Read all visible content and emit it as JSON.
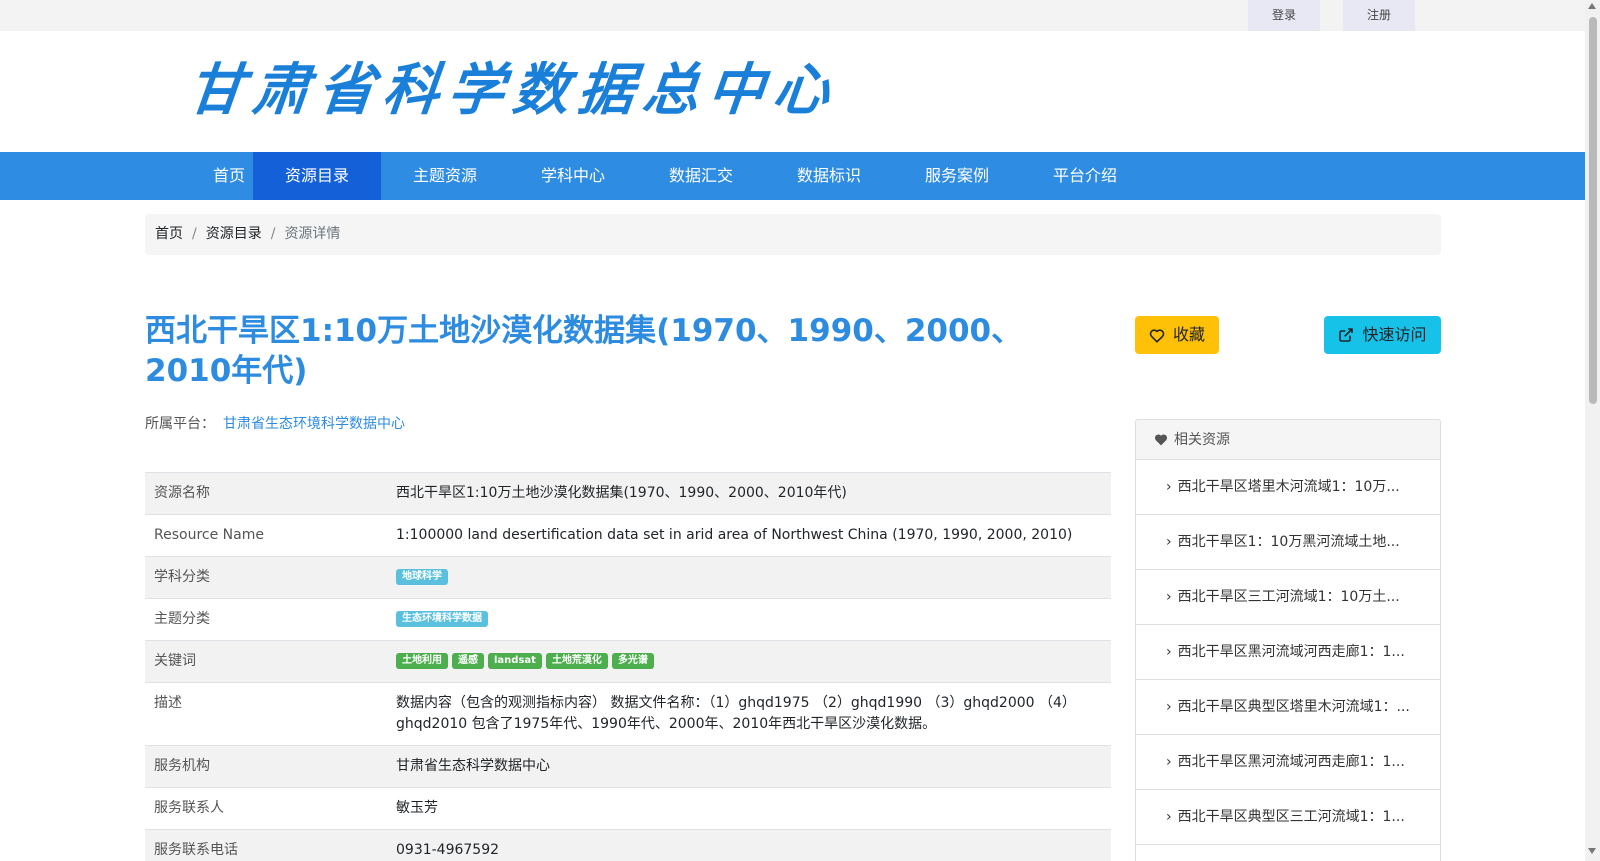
{
  "topbar": {
    "login": "登录",
    "register": "注册"
  },
  "logo": {
    "text": "甘肃省科学数据总中心"
  },
  "nav": {
    "items": [
      {
        "label": "首页",
        "active": false
      },
      {
        "label": "资源目录",
        "active": true
      },
      {
        "label": "主题资源",
        "active": false
      },
      {
        "label": "学科中心",
        "active": false
      },
      {
        "label": "数据汇交",
        "active": false
      },
      {
        "label": "数据标识",
        "active": false
      },
      {
        "label": "服务案例",
        "active": false
      },
      {
        "label": "平台介绍",
        "active": false
      }
    ]
  },
  "breadcrumb": {
    "home": "首页",
    "catalog": "资源目录",
    "current": "资源详情"
  },
  "title": "西北干旱区1:10万土地沙漠化数据集(1970、1990、2000、2010年代)",
  "actions": {
    "favorite": "收藏",
    "quick_access": "快速访问"
  },
  "platform": {
    "label": "所属平台：",
    "name": "甘肃省生态环境科学数据中心"
  },
  "details": {
    "resource_name": {
      "key": "资源名称",
      "value": "西北干旱区1:10万土地沙漠化数据集(1970、1990、2000、2010年代)"
    },
    "resource_name_en": {
      "key": "Resource Name",
      "value": "1:100000 land desertification data set in arid area of Northwest China (1970, 1990, 2000, 2010)"
    },
    "discipline": {
      "key": "学科分类",
      "tags": [
        "地球科学"
      ]
    },
    "theme": {
      "key": "主题分类",
      "tags": [
        "生态环境科学数据"
      ]
    },
    "keywords": {
      "key": "关键词",
      "tags": [
        "土地利用",
        "遥感",
        "landsat",
        "土地荒漠化",
        "多光谱"
      ]
    },
    "description": {
      "key": "描述",
      "value": "数据内容（包含的观测指标内容） 数据文件名称：（1）ghqd1975 （2）ghqd1990 （3）ghqd2000 （4）ghqd2010 包含了1975年代、1990年代、2000年、2010年西北干旱区沙漠化数据。"
    },
    "service_org": {
      "key": "服务机构",
      "value": "甘肃省生态科学数据中心"
    },
    "contact": {
      "key": "服务联系人",
      "value": "敏玉芳"
    },
    "phone": {
      "key": "服务联系电话",
      "value": "0931-4967592"
    }
  },
  "related": {
    "title": "相关资源",
    "items": [
      "西北干旱区塔里木河流域1：10万...",
      "西北干旱区1：10万黑河流域土地...",
      "西北干旱区三工河流域1：10万土...",
      "西北干旱区黑河流域河西走廊1：1...",
      "西北干旱区典型区塔里木河流域1：...",
      "西北干旱区黑河流域河西走廊1：1...",
      "西北干旱区典型区三工河流域1：1..."
    ]
  },
  "colors": {
    "nav_bg": "#2e8ce2",
    "nav_active": "#1460d9",
    "title": "#2d8ce0",
    "favorite": "#ffc107",
    "quick_access": "#17c2e9"
  },
  "icons": {
    "favorite": "heart-outline-icon",
    "quick_access": "external-link-icon",
    "related": "heart-icon",
    "related_item": "chevron-right-icon"
  }
}
